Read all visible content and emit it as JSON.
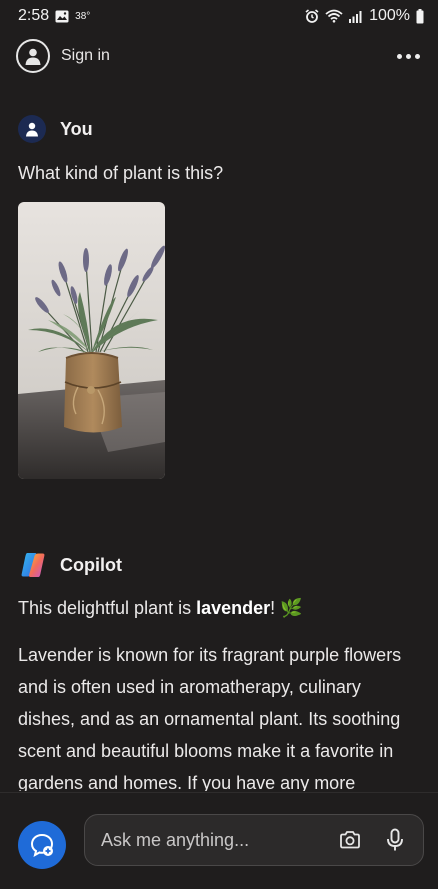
{
  "status_bar": {
    "time": "2:58",
    "temperature": "38°",
    "battery": "100%"
  },
  "app_bar": {
    "sign_in_label": "Sign in"
  },
  "conversation": {
    "user": {
      "name": "You",
      "message": "What kind of plant is this?",
      "image_alt": "lavender plant in burlap pot"
    },
    "assistant": {
      "name": "Copilot",
      "intro_prefix": "This delightful plant is ",
      "intro_bold": "lavender",
      "intro_suffix": "! 🌿",
      "body": "Lavender is known for its fragrant purple flowers and is often used in aromatherapy, culinary dishes, and as an ornamental plant. Its soothing scent and beautiful blooms make it a favorite in gardens and homes. If you have any more"
    }
  },
  "composer": {
    "placeholder": "Ask me anything..."
  },
  "colors": {
    "background": "#1f1d1d",
    "accent": "#1f6bd8",
    "user_avatar": "#1c2a52"
  },
  "icons": [
    "gallery-icon",
    "alarm-icon",
    "wifi-icon",
    "signal-icon",
    "account-icon",
    "more-icon",
    "person-icon",
    "copilot-logo-icon",
    "new-chat-icon",
    "camera-icon",
    "microphone-icon"
  ]
}
